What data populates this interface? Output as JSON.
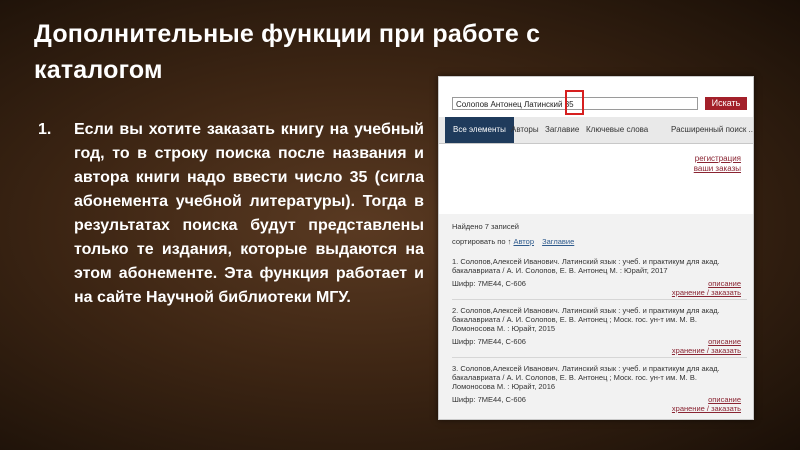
{
  "slide": {
    "title": "Дополнительные функции при работе с каталогом",
    "list_number": "1.",
    "paragraph": "Если вы хотите заказать книгу на учебный год, то в строку поиска после названия и автора книги надо ввести число 35 (сигла абонемента учебной литературы). Тогда в результатах поиска будут представлены только те издания, которые выдаются на этом абонементе. Эта функция работает и на сайте Научной библиотеки МГУ."
  },
  "catalog": {
    "search": {
      "value": "Солопов Антонец Латинский 35",
      "button_label": "Искать"
    },
    "tabs": [
      "Все элементы",
      "Авторы",
      "Заглавие",
      "Ключевые слова",
      "Расширенный поиск ..."
    ],
    "links": {
      "registration": "регистрация",
      "my_orders": "ваши заказы"
    },
    "results_count": "Найдено 7 записей",
    "sort": {
      "label": "сортировать по",
      "arrow": "↑",
      "author": "Автор",
      "title": "Заглавие"
    },
    "records": [
      {
        "text": "1. Солопов,Алексей Иванович. Латинский язык : учеб. и практикум для акад. бакалавриата / А. И. Солопов, Е. В. Антонец М. : Юрайт, 2017",
        "shelf": "Шифр: 7МЕ44, С-606",
        "description_link": "описание",
        "order_link": "хранение / заказать"
      },
      {
        "text": "2. Солопов,Алексей Иванович. Латинский язык : учеб. и практикум для акад. бакалавриата / А. И. Солопов, Е. В. Антонец ; Моск. гос. ун-т им. М. В. Ломоносова М. : Юрайт, 2015",
        "shelf": "Шифр: 7МЕ44, С-606",
        "description_link": "описание",
        "order_link": "хранение / заказать"
      },
      {
        "text": "3. Солопов,Алексей Иванович. Латинский язык : учеб. и практикум для акад. бакалавриата / А. И. Солопов, Е. В. Антонец ; Моск. гос. ун-т им. М. В. Ломоносова М. : Юрайт, 2016",
        "shelf": "Шифр: 7МЕ44, С-606",
        "description_link": "описание",
        "order_link": "хранение / заказать"
      }
    ]
  },
  "colors": {
    "background": "#3e2614",
    "accent_button": "#a3202a",
    "active_tab": "#1f3b5c",
    "highlight": "#d61f1f",
    "link": "#8a2432"
  }
}
